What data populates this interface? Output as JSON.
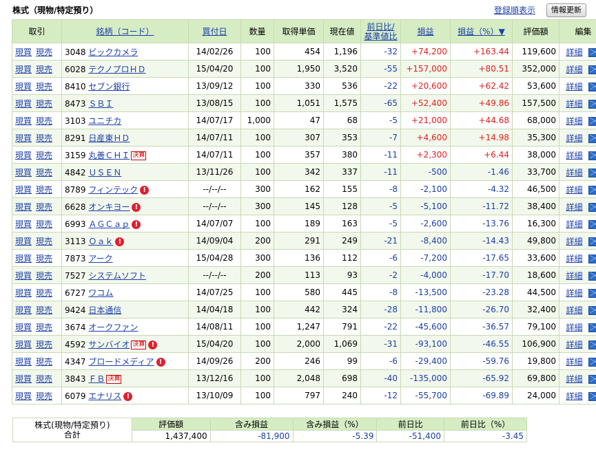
{
  "header": {
    "title": "株式（現物/特定預り）",
    "sort_link": "登録順表示",
    "refresh_button": "情報更新"
  },
  "table": {
    "headers": {
      "trade": "取引",
      "name": "銘柄（コード）",
      "date": "買付日",
      "qty": "数量",
      "cost": "取得単価",
      "price": "現在値",
      "change_1": "前日比/",
      "change_2": "基準値比",
      "pl": "損益",
      "plpct": "損益（%）▼",
      "value": "評価額",
      "edit": "編集"
    },
    "buy_label": "現買",
    "sell_label": "現売",
    "detail_label": "詳細",
    "rows": [
      {
        "code": "3048",
        "name": "ビックカメラ",
        "badge": "",
        "alert": "",
        "date": "14/02/26",
        "qty": "100",
        "cost": "454",
        "price": "1,196",
        "change": "-32",
        "pl": "+74,200",
        "plpct": "+163.44",
        "value": "119,600"
      },
      {
        "code": "6028",
        "name": "テクノプロＨＤ",
        "badge": "",
        "alert": "",
        "date": "15/04/20",
        "qty": "100",
        "cost": "1,950",
        "price": "3,520",
        "change": "-55",
        "pl": "+157,000",
        "plpct": "+80.51",
        "value": "352,000"
      },
      {
        "code": "8410",
        "name": "セブン銀行",
        "badge": "",
        "alert": "",
        "date": "13/09/12",
        "qty": "100",
        "cost": "330",
        "price": "536",
        "change": "-22",
        "pl": "+20,600",
        "plpct": "+62.42",
        "value": "53,600"
      },
      {
        "code": "8473",
        "name": "ＳＢＩ",
        "badge": "",
        "alert": "",
        "date": "13/08/15",
        "qty": "100",
        "cost": "1,051",
        "price": "1,575",
        "change": "-65",
        "pl": "+52,400",
        "plpct": "+49.86",
        "value": "157,500"
      },
      {
        "code": "3103",
        "name": "ユニチカ",
        "badge": "",
        "alert": "",
        "date": "14/07/17",
        "qty": "1,000",
        "cost": "47",
        "price": "68",
        "change": "-5",
        "pl": "+21,000",
        "plpct": "+44.68",
        "value": "68,000"
      },
      {
        "code": "8291",
        "name": "日産東ＨＤ",
        "badge": "",
        "alert": "",
        "date": "14/07/11",
        "qty": "100",
        "cost": "307",
        "price": "353",
        "change": "-7",
        "pl": "+4,600",
        "plpct": "+14.98",
        "value": "35,300"
      },
      {
        "code": "3159",
        "name": "丸善ＣＨＩ",
        "badge": "決算",
        "alert": "",
        "date": "14/07/11",
        "qty": "100",
        "cost": "357",
        "price": "380",
        "change": "-11",
        "pl": "+2,300",
        "plpct": "+6.44",
        "value": "38,000"
      },
      {
        "code": "4842",
        "name": "ＵＳＥＮ",
        "badge": "",
        "alert": "",
        "date": "13/11/26",
        "qty": "100",
        "cost": "342",
        "price": "337",
        "change": "-11",
        "pl": "-500",
        "plpct": "-1.46",
        "value": "33,700"
      },
      {
        "code": "8789",
        "name": "フィンテック",
        "badge": "",
        "alert": "!",
        "date": "--/--/--",
        "qty": "300",
        "cost": "162",
        "price": "155",
        "change": "-8",
        "pl": "-2,100",
        "plpct": "-4.32",
        "value": "46,500"
      },
      {
        "code": "6628",
        "name": "オンキヨー",
        "badge": "",
        "alert": "!",
        "date": "--/--/--",
        "qty": "300",
        "cost": "145",
        "price": "128",
        "change": "-5",
        "pl": "-5,100",
        "plpct": "-11.72",
        "value": "38,400"
      },
      {
        "code": "6993",
        "name": "ＡＧＣａｐ",
        "badge": "",
        "alert": "!",
        "date": "14/07/07",
        "qty": "100",
        "cost": "189",
        "price": "163",
        "change": "-5",
        "pl": "-2,600",
        "plpct": "-13.76",
        "value": "16,300"
      },
      {
        "code": "3113",
        "name": "Ｏａｋ",
        "badge": "",
        "alert": "!",
        "date": "14/09/04",
        "qty": "200",
        "cost": "291",
        "price": "249",
        "change": "-21",
        "pl": "-8,400",
        "plpct": "-14.43",
        "value": "49,800"
      },
      {
        "code": "7873",
        "name": "アーク",
        "badge": "",
        "alert": "",
        "date": "15/04/28",
        "qty": "300",
        "cost": "136",
        "price": "112",
        "change": "-6",
        "pl": "-7,200",
        "plpct": "-17.65",
        "value": "33,600"
      },
      {
        "code": "7527",
        "name": "システムソフト",
        "badge": "",
        "alert": "",
        "date": "--/--/--",
        "qty": "200",
        "cost": "113",
        "price": "93",
        "change": "-2",
        "pl": "-4,000",
        "plpct": "-17.70",
        "value": "18,600"
      },
      {
        "code": "6727",
        "name": "ワコム",
        "badge": "",
        "alert": "",
        "date": "14/07/25",
        "qty": "100",
        "cost": "580",
        "price": "445",
        "change": "-8",
        "pl": "-13,500",
        "plpct": "-23.28",
        "value": "44,500"
      },
      {
        "code": "9424",
        "name": "日本通信",
        "badge": "",
        "alert": "",
        "date": "14/04/18",
        "qty": "100",
        "cost": "442",
        "price": "324",
        "change": "-28",
        "pl": "-11,800",
        "plpct": "-26.70",
        "value": "32,400"
      },
      {
        "code": "3674",
        "name": "オークファン",
        "badge": "",
        "alert": "",
        "date": "14/08/11",
        "qty": "100",
        "cost": "1,247",
        "price": "791",
        "change": "-22",
        "pl": "-45,600",
        "plpct": "-36.57",
        "value": "79,100"
      },
      {
        "code": "4592",
        "name": "サンバイオ",
        "badge": "決算",
        "alert": "!",
        "date": "15/04/20",
        "qty": "100",
        "cost": "2,000",
        "price": "1,069",
        "change": "-31",
        "pl": "-93,100",
        "plpct": "-46.55",
        "value": "106,900"
      },
      {
        "code": "4347",
        "name": "ブロードメディア",
        "badge": "",
        "alert": "!",
        "date": "14/09/26",
        "qty": "200",
        "cost": "246",
        "price": "99",
        "change": "-6",
        "pl": "-29,400",
        "plpct": "-59.76",
        "value": "19,800"
      },
      {
        "code": "3843",
        "name": "ＦＢ",
        "badge": "決算",
        "alert": "",
        "date": "13/12/16",
        "qty": "100",
        "cost": "2,048",
        "price": "698",
        "change": "-40",
        "pl": "-135,000",
        "plpct": "-65.92",
        "value": "69,800"
      },
      {
        "code": "6079",
        "name": "エナリス",
        "badge": "",
        "alert": "!",
        "date": "13/10/09",
        "qty": "100",
        "cost": "797",
        "price": "240",
        "change": "-12",
        "pl": "-55,700",
        "plpct": "-69.89",
        "value": "24,000"
      }
    ]
  },
  "summary": {
    "label_1": "株式(現物/特定預り)",
    "label_2": "合計",
    "headers": [
      "評価額",
      "含み損益",
      "含み損益（%）",
      "前日比",
      "前日比（%）"
    ],
    "values": [
      "1,437,400",
      "-81,900",
      "-5.39",
      "-51,400",
      "-3.45"
    ]
  },
  "colors": {
    "header_bg": "#d6ecc3",
    "border": "#c8d9b4",
    "positive": "#e02020",
    "negative": "#1a3ea8",
    "link": "#1a3ea8",
    "alert": "#e0202f",
    "badge": "#cc0000"
  },
  "icons": [
    "alert-icon",
    "mail-icon"
  ]
}
